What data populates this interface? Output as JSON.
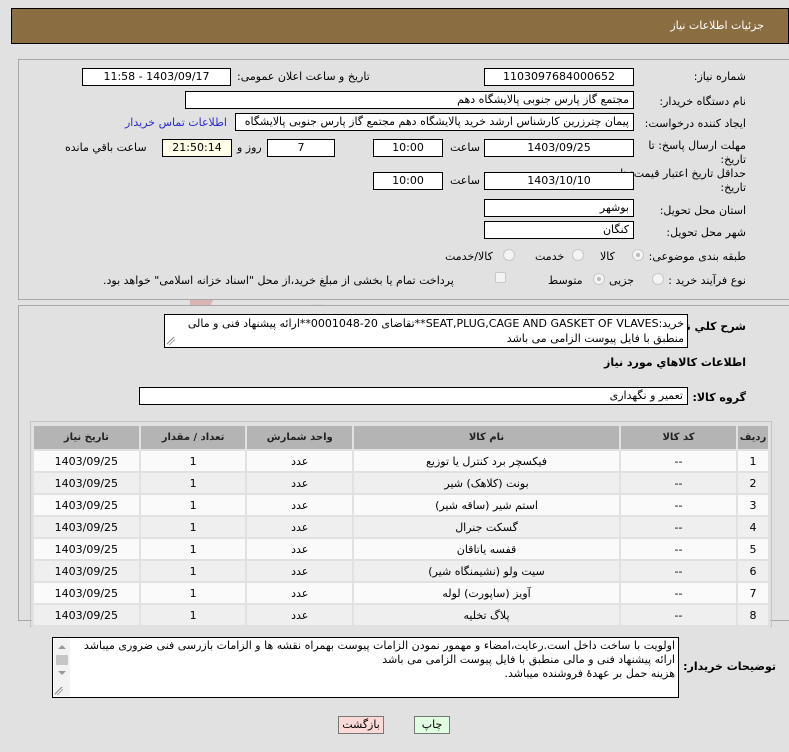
{
  "header": {
    "title": "جزئیات اطلاعات نیاز"
  },
  "form": {
    "need_number": {
      "label": "شماره نیاز:",
      "value": "1103097684000652"
    },
    "announce_datetime": {
      "label": "تاریخ و ساعت اعلان عمومی:",
      "value": "1403/09/17 - 11:58"
    },
    "buyer_org": {
      "label": "نام دستگاه خریدار:",
      "value": "مجتمع گاز پارس جنوبی  پالایشگاه دهم"
    },
    "requester": {
      "label": "ایجاد کننده درخواست:",
      "value": "پیمان چترزرین کارشناس ارشد خرید پالایشگاه دهم مجتمع گاز پارس جنوبی  پالایشگاه",
      "contact_link": "اطلاعات تماس خریدار"
    },
    "response_deadline": {
      "label_line1": "مهلت ارسال پاسخ: تا",
      "label_line2": "تاریخ:",
      "date": "1403/09/25",
      "time_label": "ساعت",
      "time": "10:00",
      "days": "7",
      "days_label": "روز و",
      "remaining": "21:50:14",
      "remaining_label": "ساعت باقي مانده"
    },
    "price_validity": {
      "label_line1": "حداقل تاریخ اعتبار قیمت: تا",
      "label_line2": "تاریخ:",
      "date": "1403/10/10",
      "time_label": "ساعت",
      "time": "10:00"
    },
    "province": {
      "label": "استان محل تحویل:",
      "value": "بوشهر"
    },
    "city": {
      "label": "شهر محل تحویل:",
      "value": "کنگان"
    },
    "category": {
      "label": "طبقه بندی موضوعی:",
      "options": [
        "کالا",
        "خدمت",
        "کالا/خدمت"
      ],
      "selected": "کالا"
    },
    "purchase_type": {
      "label": "نوع فرآیند خرید :",
      "options": [
        "جزیی",
        "متوسط"
      ],
      "selected": "متوسط",
      "treasury_checkbox_label": "پرداخت تمام یا بخشی از مبلغ خرید،از محل \"اسناد خزانه اسلامی\" خواهد بود.",
      "treasury_checked": false
    }
  },
  "description": {
    "label": "شرح کلي نياز:",
    "text": "خرید:SEAT,PLUG,CAGE AND GASKET OF VLAVES**تقاضای 20-0001048**ارائه پیشنهاد فنی و مالی منطبق با فایل پیوست الزامی می باشد"
  },
  "goods_section": {
    "title": "اطلاعات کالاهاي مورد نياز",
    "group_label": "گروه کالا:",
    "group_value": "تعمیر و نگهداری"
  },
  "table": {
    "headers": [
      "ردیف",
      "کد کالا",
      "نام کالا",
      "واحد شمارش",
      "تعداد / مقدار",
      "تاریخ نیاز"
    ],
    "rows": [
      [
        "1",
        "--",
        "فیکسچر برد کنترل یا توزیع",
        "عدد",
        "1",
        "1403/09/25"
      ],
      [
        "2",
        "--",
        "بونت (کلاهک) شیر",
        "عدد",
        "1",
        "1403/09/25"
      ],
      [
        "3",
        "--",
        "استم شیر (ساقه شیر)",
        "عدد",
        "1",
        "1403/09/25"
      ],
      [
        "4",
        "--",
        "گسکت جنرال",
        "عدد",
        "1",
        "1403/09/25"
      ],
      [
        "5",
        "--",
        "قفسه یاتاقان",
        "عدد",
        "1",
        "1403/09/25"
      ],
      [
        "6",
        "--",
        "سیت ولو (نشیمنگاه شیر)",
        "عدد",
        "1",
        "1403/09/25"
      ],
      [
        "7",
        "--",
        "آویز (ساپورت) لوله",
        "عدد",
        "1",
        "1403/09/25"
      ],
      [
        "8",
        "--",
        "پلاگ تخلیه",
        "عدد",
        "1",
        "1403/09/25"
      ]
    ]
  },
  "buyer_notes": {
    "label": "توضیحات خریدار:",
    "lines": [
      "اولویت با ساخت داخل است.رعایت،امضاء و مهمور نمودن الزامات پیوست بهمراه نقشه ها و الزامات بازرسی فنی ضروری میباشد",
      "ارائه پیشنهاد فنی و مالی منطبق با فایل پیوست الزامی می باشد",
      " هزینه حمل بر عهدهٔ فروشنده میباشد."
    ]
  },
  "buttons": {
    "print": "چاپ",
    "back": "بازگشت"
  },
  "colors": {
    "header_bg": "#8b6d42",
    "back_bg": "#fcd9d9",
    "print_bg": "#e1fde1",
    "link": "#2a2ad0"
  }
}
